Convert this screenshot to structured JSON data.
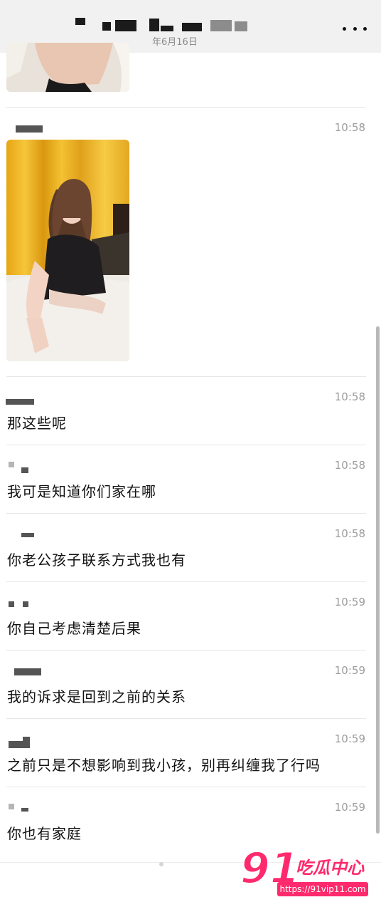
{
  "header": {
    "date": "年6月16日"
  },
  "messages": [
    {
      "time": "10:58",
      "text": ""
    },
    {
      "time": "10:58",
      "text": "那这些呢"
    },
    {
      "time": "10:58",
      "text": "我可是知道你们家在哪"
    },
    {
      "time": "10:58",
      "text": "你老公孩子联系方式我也有"
    },
    {
      "time": "10:59",
      "text": "你自己考虑清楚后果"
    },
    {
      "time": "10:59",
      "text": "我的诉求是回到之前的关系"
    },
    {
      "time": "10:59",
      "text": "之前只是不想影响到我小孩，别再纠缠我了行吗"
    },
    {
      "time": "10:59",
      "text": "你也有家庭"
    }
  ],
  "watermark": {
    "number": "91",
    "title": "吃瓜中心",
    "url": "https://91vip11.com"
  },
  "colors": {
    "header_bg": "#f1f1f1",
    "text": "#111111",
    "time": "#9c9c9c",
    "watermark": "#ff2a6d"
  }
}
